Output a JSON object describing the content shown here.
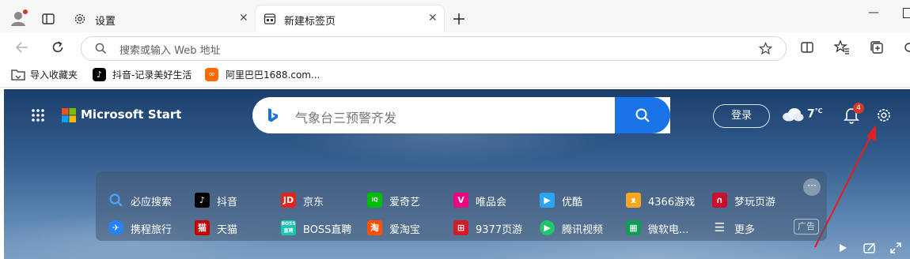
{
  "browser": {
    "tabs": [
      {
        "label": "设置"
      },
      {
        "label": "新建标签页"
      }
    ],
    "address_placeholder": "搜索或输入 Web 地址",
    "favorites": [
      {
        "label": "导入收藏夹"
      },
      {
        "label": "抖音-记录美好生活"
      },
      {
        "label": "阿里巴巴1688.com..."
      }
    ]
  },
  "page": {
    "brand": "Microsoft Start",
    "search_placeholder": "气象台三预警齐发",
    "login_label": "登录",
    "weather": {
      "temp": "7",
      "unit": "℃"
    },
    "notification_count": "4",
    "quick_links": [
      {
        "label": "必应搜索",
        "color": "#2a8cf0"
      },
      {
        "label": "抖音",
        "color": "#000000"
      },
      {
        "label": "京东",
        "color": "#e1251b"
      },
      {
        "label": "爱奇艺",
        "color": "#00be06"
      },
      {
        "label": "唯品会",
        "color": "#f10180"
      },
      {
        "label": "优酷",
        "color": "#2ba4f6"
      },
      {
        "label": "4366游戏",
        "color": "#f5a623"
      },
      {
        "label": "梦玩页游",
        "color": "#c8102e"
      },
      {
        "label": "携程旅行",
        "color": "#2681ff"
      },
      {
        "label": "天猫",
        "color": "#c40000"
      },
      {
        "label": "BOSS直聘",
        "color": "#19c6b2"
      },
      {
        "label": "爱淘宝",
        "color": "#ff5000"
      },
      {
        "label": "9377页游",
        "color": "#d21a2a"
      },
      {
        "label": "腾讯视频",
        "color": "#20c76a"
      },
      {
        "label": "微软电...",
        "color": "#0f9d58"
      },
      {
        "label": "更多",
        "color": "#ffffff"
      }
    ],
    "more_dots": "···",
    "ad_label": "广告"
  }
}
